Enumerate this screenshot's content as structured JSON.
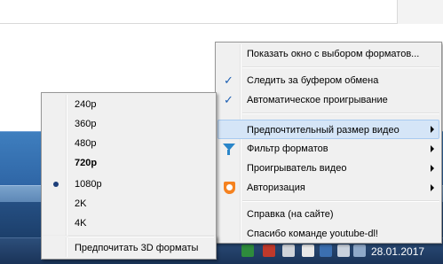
{
  "main_menu": {
    "items": [
      {
        "label": "Показать окно с выбором форматов...",
        "checked": false,
        "submenu": false,
        "icon": null
      },
      {
        "label": "Следить за буфером обмена",
        "checked": true,
        "submenu": false,
        "icon": null
      },
      {
        "label": "Автоматическое проигрывание",
        "checked": true,
        "submenu": false,
        "icon": null
      },
      {
        "label": "Предпочтительный размер видео",
        "checked": false,
        "submenu": true,
        "icon": null,
        "highlighted": true
      },
      {
        "label": "Фильтр форматов",
        "checked": false,
        "submenu": true,
        "icon": "filter-icon"
      },
      {
        "label": "Проигрыватель видео",
        "checked": false,
        "submenu": true,
        "icon": null
      },
      {
        "label": "Авторизация",
        "checked": false,
        "submenu": true,
        "icon": "shield-icon"
      },
      {
        "label": "Справка (на сайте)",
        "checked": false,
        "submenu": false,
        "icon": null
      },
      {
        "label": "Спасибо команде youtube-dl!",
        "checked": false,
        "submenu": false,
        "icon": null
      }
    ]
  },
  "size_menu": {
    "items": [
      {
        "label": "240p"
      },
      {
        "label": "360p"
      },
      {
        "label": "480p"
      },
      {
        "label": "720p",
        "bold": true
      },
      {
        "label": "1080p",
        "selected": true
      },
      {
        "label": "2K"
      },
      {
        "label": "4K"
      },
      {
        "label": "Предпочитать 3D форматы"
      }
    ]
  },
  "taskbar": {
    "clock": "28.01.2017",
    "tray_icons": [
      "green-app-icon",
      "red-app-icon",
      "app-icon",
      "app-icon",
      "app-icon",
      "app-icon",
      "app-icon"
    ]
  },
  "colors": {
    "menu_bg": "#f0f0f0",
    "highlight": "#d5e5f7",
    "check": "#1d5fb3",
    "taskbar": "#1a3358"
  }
}
